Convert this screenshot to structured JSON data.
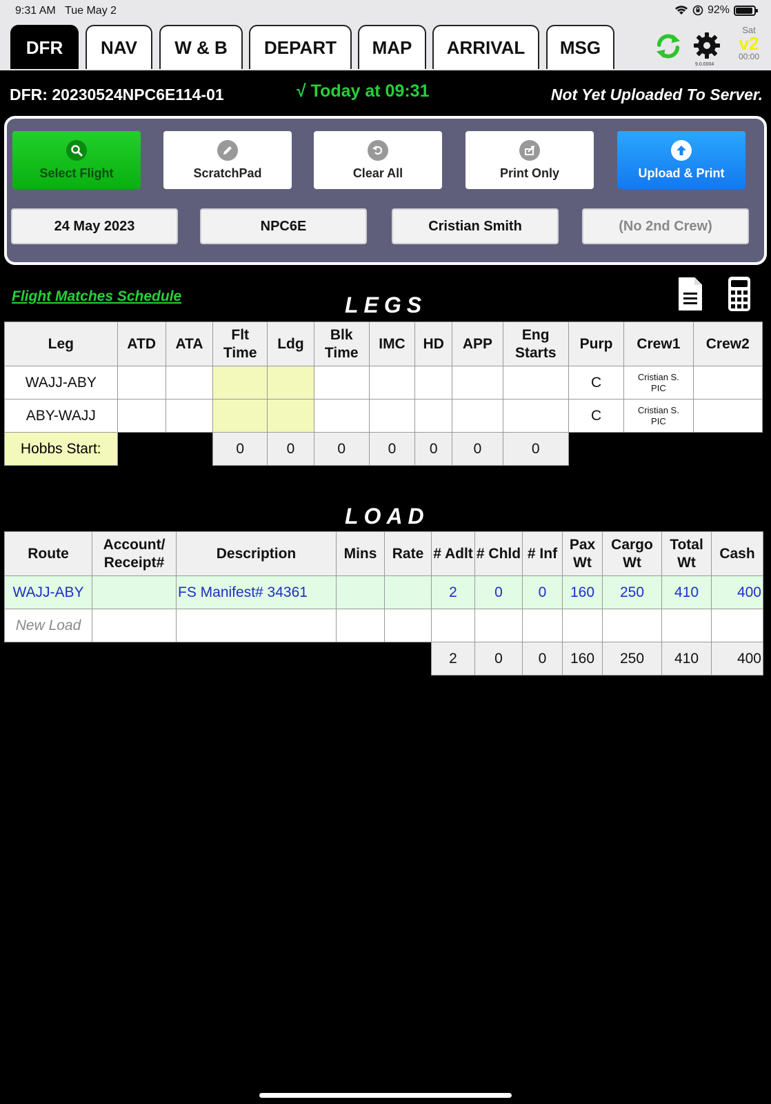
{
  "status_bar": {
    "time": "9:31 AM",
    "date": "Tue May 2",
    "battery": "92%",
    "battery_level": 0.92
  },
  "tabs": [
    {
      "label": "DFR",
      "active": true
    },
    {
      "label": "NAV"
    },
    {
      "label": "W & B"
    },
    {
      "label": "DEPART"
    },
    {
      "label": "MAP"
    },
    {
      "label": "ARRIVAL"
    },
    {
      "label": "MSG"
    }
  ],
  "toolbar": {
    "version": "9.0.0004",
    "sat_day": "Sat",
    "sat_version": "v2",
    "sat_time": "00:00"
  },
  "header": {
    "dfr_id": "DFR: 20230524NPC6E114-01",
    "today": "√ Today at 09:31",
    "upload_status": "Not Yet Uploaded To Server."
  },
  "buttons": {
    "select_flight": "Select Flight",
    "scratchpad": "ScratchPad",
    "clear_all": "Clear All",
    "print_only": "Print Only",
    "upload_print": "Upload & Print"
  },
  "fields": {
    "date": "24 May 2023",
    "aircraft": "NPC6E",
    "crew1": "Cristian Smith",
    "crew2": "(No 2nd Crew)"
  },
  "flight_match": "Flight Matches Schedule",
  "legs": {
    "title": "LEGS",
    "headers": [
      "Leg",
      "ATD",
      "ATA",
      "Flt Time",
      "Ldg",
      "Blk Time",
      "IMC",
      "HD",
      "APP",
      "Eng Starts",
      "Purp",
      "Crew1",
      "Crew2"
    ],
    "rows": [
      {
        "leg": "WAJJ-ABY",
        "purp": "C",
        "crew1_name": "Cristian S.",
        "crew1_role": "PIC"
      },
      {
        "leg": "ABY-WAJJ",
        "purp": "C",
        "crew1_name": "Cristian S.",
        "crew1_role": "PIC"
      }
    ],
    "hobbs": {
      "label": "Hobbs Start:",
      "values": [
        "0",
        "0",
        "0",
        "0",
        "0",
        "0",
        "0"
      ]
    }
  },
  "load": {
    "title": "LOAD",
    "headers": [
      "Route",
      "Account/ Receipt#",
      "Description",
      "Mins",
      "Rate",
      "# Adlt",
      "# Chld",
      "# Inf",
      "Pax Wt",
      "Cargo Wt",
      "Total Wt",
      "Cash"
    ],
    "rows": [
      {
        "route": "WAJJ-ABY",
        "account": "",
        "description": "FS Manifest# 34361",
        "mins": "",
        "rate": "",
        "adlt": "2",
        "chld": "0",
        "inf": "0",
        "pax_wt": "160",
        "cargo_wt": "250",
        "total_wt": "410",
        "cash": "400"
      }
    ],
    "new_load": "New Load",
    "totals": {
      "adlt": "2",
      "chld": "0",
      "inf": "0",
      "pax_wt": "160",
      "cargo_wt": "250",
      "total_wt": "410",
      "cash": "400"
    }
  },
  "colors": {
    "accent_green": "#26d03a",
    "upload_blue": "#1a86f5",
    "panel": "#5f5f7c",
    "yellow_cell": "#f3f8bb",
    "mint_row": "#e2fbe4"
  }
}
